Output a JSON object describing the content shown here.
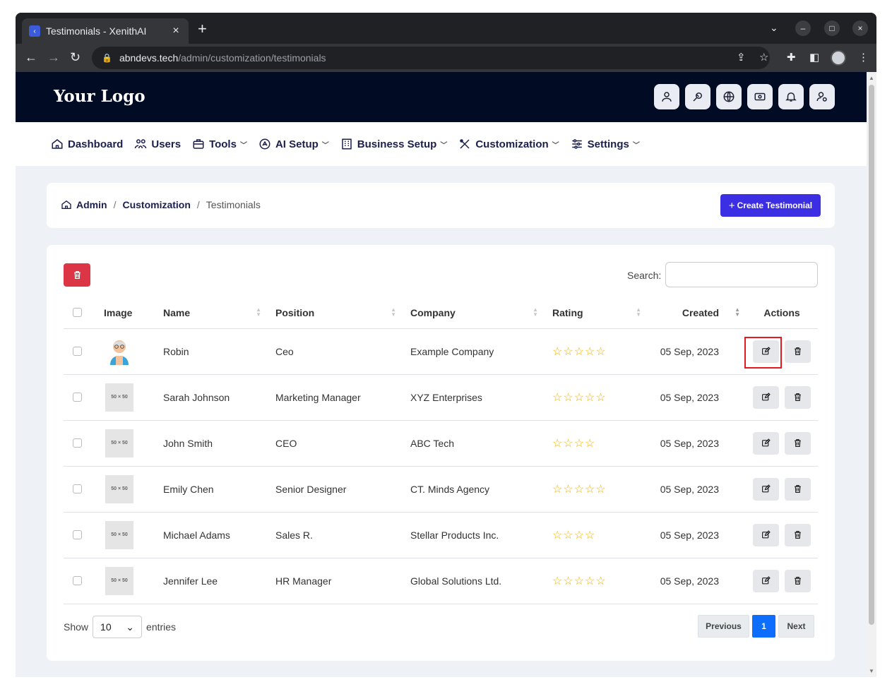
{
  "browser": {
    "tab_title": "Testimonials - XenithAI",
    "url_host": "abndevs.tech",
    "url_path": "/admin/customization/testimonials"
  },
  "header": {
    "logo": "Your Logo",
    "icons": [
      "user-icon",
      "theme-icon",
      "globe-icon",
      "currency-icon",
      "bell-icon",
      "user-settings-icon"
    ]
  },
  "nav": {
    "items": [
      {
        "label": "Dashboard",
        "icon": "home-icon",
        "dropdown": false
      },
      {
        "label": "Users",
        "icon": "users-icon",
        "dropdown": false
      },
      {
        "label": "Tools",
        "icon": "briefcase-icon",
        "dropdown": true
      },
      {
        "label": "AI Setup",
        "icon": "ai-icon",
        "dropdown": true
      },
      {
        "label": "Business Setup",
        "icon": "building-icon",
        "dropdown": true
      },
      {
        "label": "Customization",
        "icon": "tools-icon",
        "dropdown": true
      },
      {
        "label": "Settings",
        "icon": "sliders-icon",
        "dropdown": true
      }
    ]
  },
  "breadcrumb": {
    "admin": "Admin",
    "customization": "Customization",
    "current": "Testimonials",
    "separator": "/"
  },
  "create_button": "Create Testimonial",
  "search": {
    "label": "Search:",
    "value": ""
  },
  "table": {
    "headers": {
      "image": "Image",
      "name": "Name",
      "position": "Position",
      "company": "Company",
      "rating": "Rating",
      "created": "Created",
      "actions": "Actions"
    },
    "placeholder_text": "50 × 50",
    "rows": [
      {
        "name": "Robin",
        "position": "Ceo",
        "company": "Example Company",
        "rating": 5,
        "created": "05 Sep, 2023",
        "image": "avatar"
      },
      {
        "name": "Sarah Johnson",
        "position": "Marketing Manager",
        "company": "XYZ Enterprises",
        "rating": 5,
        "created": "05 Sep, 2023",
        "image": "placeholder"
      },
      {
        "name": "John Smith",
        "position": "CEO",
        "company": "ABC Tech",
        "rating": 4,
        "created": "05 Sep, 2023",
        "image": "placeholder"
      },
      {
        "name": "Emily Chen",
        "position": "Senior Designer",
        "company": "CT. Minds Agency",
        "rating": 5,
        "created": "05 Sep, 2023",
        "image": "placeholder"
      },
      {
        "name": "Michael Adams",
        "position": "Sales R.",
        "company": "Stellar Products Inc.",
        "rating": 4,
        "created": "05 Sep, 2023",
        "image": "placeholder"
      },
      {
        "name": "Jennifer Lee",
        "position": "HR Manager",
        "company": "Global Solutions Ltd.",
        "rating": 5,
        "created": "05 Sep, 2023",
        "image": "placeholder"
      }
    ]
  },
  "footer": {
    "show": "Show",
    "entries_value": "10",
    "entries": "entries",
    "previous": "Previous",
    "page": "1",
    "next": "Next"
  },
  "colors": {
    "header_bg": "#020b24",
    "primary": "#3c2fe3",
    "danger": "#dc3545",
    "star": "#f3b300",
    "page_active": "#0d6efd"
  }
}
